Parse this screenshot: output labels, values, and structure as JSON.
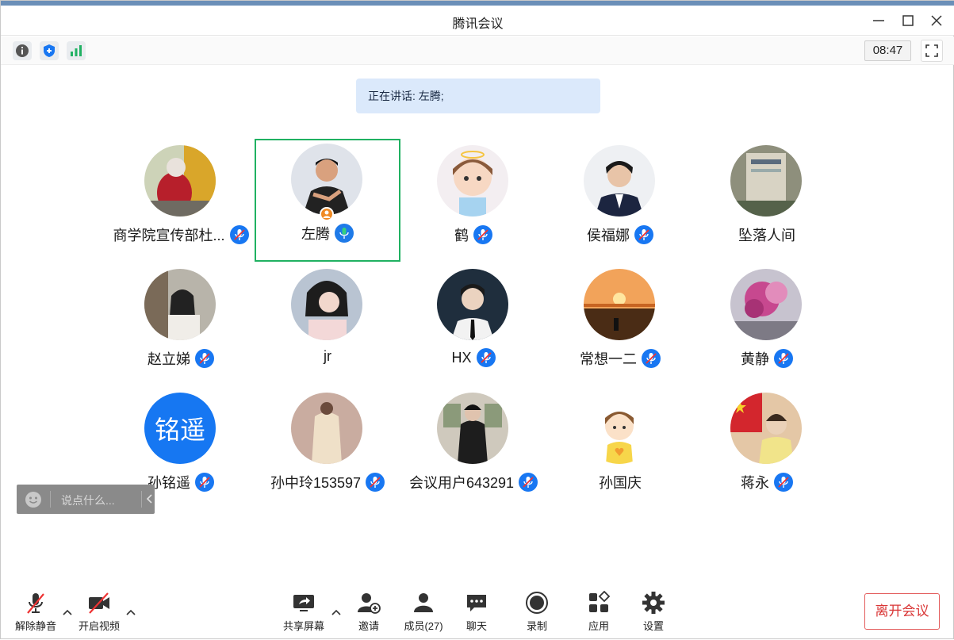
{
  "window": {
    "title": "腾讯会议"
  },
  "header": {
    "clock": "08:47"
  },
  "speaking": {
    "text": "正在讲话: 左腾;"
  },
  "participants": [
    {
      "name": "商学院宣传部杜...",
      "mic": "muted"
    },
    {
      "name": "左腾",
      "mic": "active",
      "host": true
    },
    {
      "name": "鹤",
      "mic": "muted"
    },
    {
      "name": "侯福娜",
      "mic": "muted"
    },
    {
      "name": "坠落人间",
      "mic": "none"
    },
    {
      "name": "赵立娣",
      "mic": "muted"
    },
    {
      "name": "jr",
      "mic": "none"
    },
    {
      "name": "HX",
      "mic": "muted"
    },
    {
      "name": "常想一二",
      "mic": "muted"
    },
    {
      "name": "黄静",
      "mic": "muted"
    },
    {
      "name": "孙铭遥",
      "mic": "muted",
      "avatar_text": "铭遥"
    },
    {
      "name": "孙中玲153597",
      "mic": "muted"
    },
    {
      "name": "会议用户643291",
      "mic": "muted"
    },
    {
      "name": "孙国庆",
      "mic": "none"
    },
    {
      "name": "蒋永",
      "mic": "muted"
    }
  ],
  "chat": {
    "placeholder": "说点什么..."
  },
  "toolbar": {
    "unmute": "解除静音",
    "video": "开启视频",
    "share": "共享屏幕",
    "invite": "邀请",
    "members": "成员(27)",
    "chat": "聊天",
    "record": "录制",
    "apps": "应用",
    "settings": "设置",
    "leave": "离开会议"
  },
  "colors": {
    "accent": "#1877f2",
    "active_border": "#20b162",
    "leave": "#d93636",
    "speaking_bg": "#dbe9fb"
  }
}
